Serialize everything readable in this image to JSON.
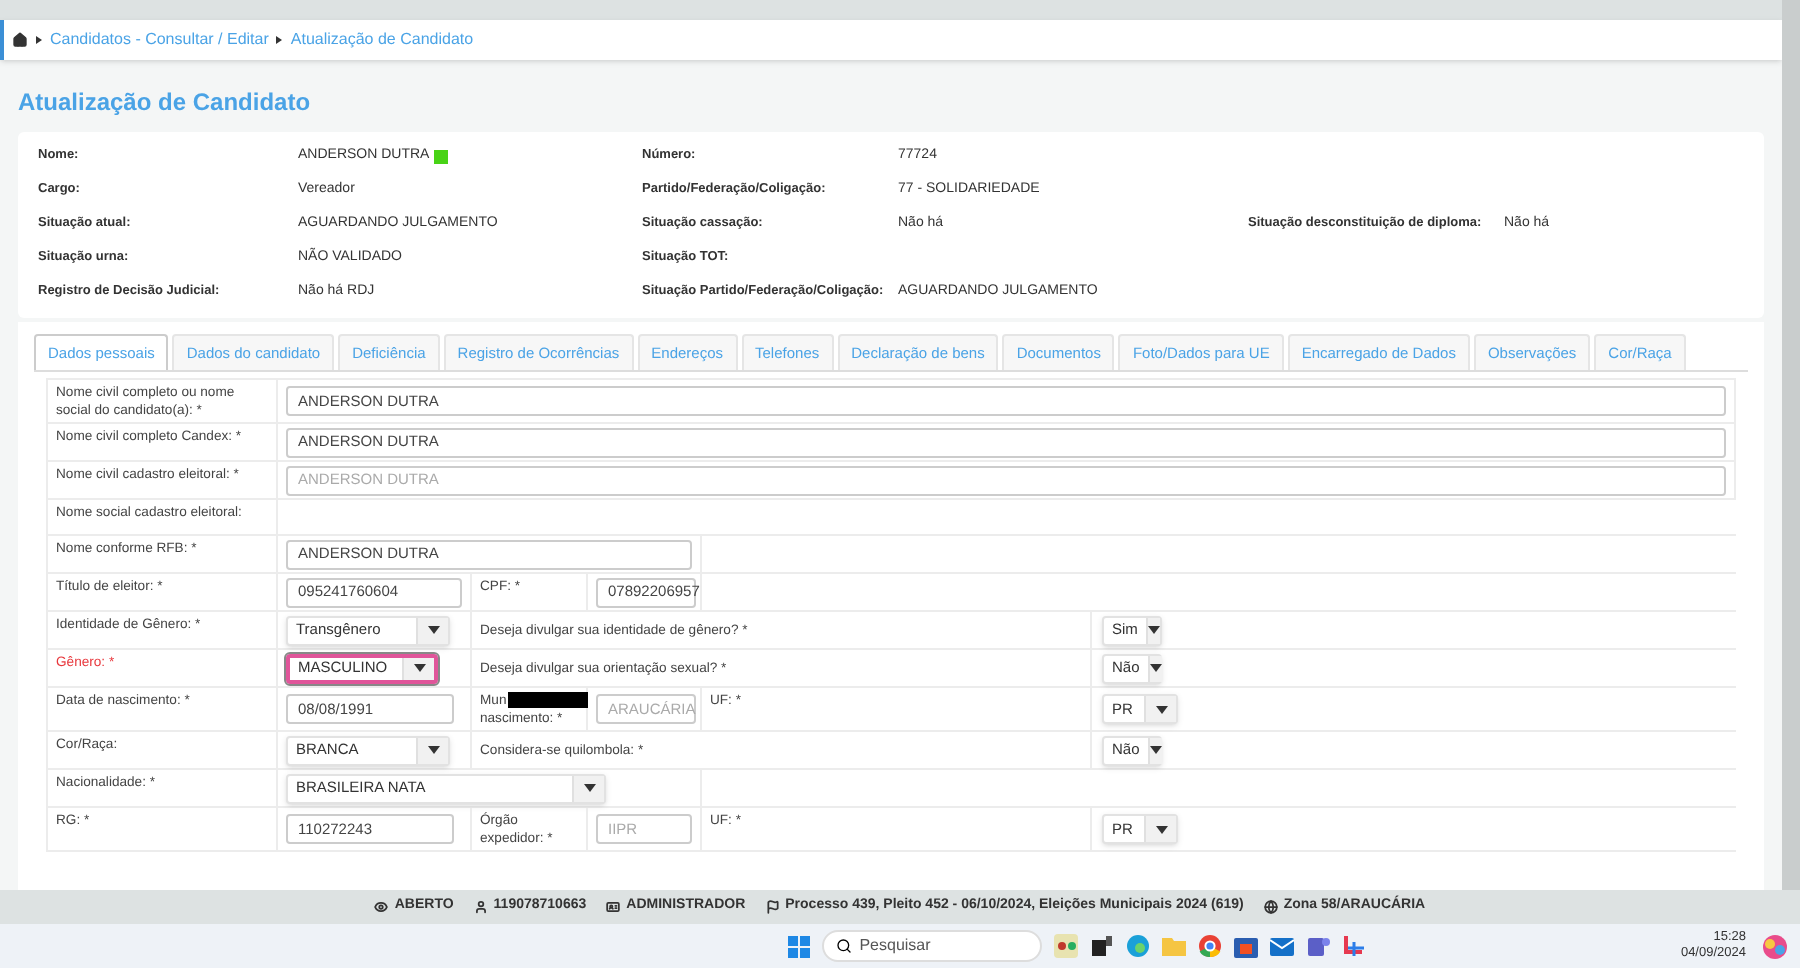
{
  "breadcrumb": [
    "Candidatos - Consultar / Editar",
    "Atualização de Candidato"
  ],
  "page_title": "Atualização de Candidato",
  "summary": [
    {
      "label": "Nome:",
      "value": "ANDERSON DUTRA",
      "badge": true,
      "label2": "Número:",
      "value2": "77724"
    },
    {
      "label": "Cargo:",
      "value": "Vereador",
      "badge": false,
      "label2": "Partido/Federação/Coligação:",
      "value2": "77 - SOLIDARIEDADE"
    },
    {
      "label": "Situação atual:",
      "value": "AGUARDANDO JULGAMENTO",
      "badge": false,
      "label2": "Situação cassação:",
      "value2": "Não há",
      "label3": "Situação desconstituição de diploma:",
      "value3": "Não há"
    },
    {
      "label": "Situação urna:",
      "value": "NÃO VALIDADO",
      "badge": false,
      "label2": "Situação TOT:"
    },
    {
      "label": "Registro de Decisão Judicial:",
      "value": "Não há RDJ",
      "badge": false,
      "label2": "Situação Partido/Federação/Coligação:",
      "value2": "AGUARDANDO JULGAMENTO"
    }
  ],
  "tabs": [
    {
      "label": "Dados pessoais",
      "selected": true
    },
    {
      "label": "Dados do candidato",
      "selected": false
    },
    {
      "label": "Deficiência",
      "selected": false
    },
    {
      "label": "Registro de Ocorrências",
      "selected": false
    },
    {
      "label": "Endereços",
      "selected": false
    },
    {
      "label": "Telefones",
      "selected": false
    },
    {
      "label": "Declaração de bens",
      "selected": false
    },
    {
      "label": "Documentos",
      "selected": false
    },
    {
      "label": "Foto/Dados para UE",
      "selected": false
    },
    {
      "label": "Encarregado de Dados",
      "selected": false
    },
    {
      "label": "Observações",
      "selected": false
    },
    {
      "label": "Cor/Raça",
      "selected": false
    }
  ],
  "form_rows": [
    {
      "kind": "full",
      "label": "Nome civil completo ou nome social do candidato(a): *",
      "value": "ANDERSON DUTRA",
      "disabled": false
    },
    {
      "kind": "full",
      "label": "Nome civil completo Candex: *",
      "value": "ANDERSON DUTRA",
      "disabled": false
    },
    {
      "kind": "full",
      "label": "Nome civil cadastro eleitoral: *",
      "value": "ANDERSON DUTRA",
      "disabled": true
    },
    {
      "kind": "label-only",
      "label": "Nome social cadastro eleitoral:"
    },
    {
      "kind": "medium",
      "label": "Nome conforme RFB: *",
      "value": "ANDERSON DUTRA"
    },
    {
      "kind": "pair",
      "label": "Título de eleitor: *",
      "value": "095241760604",
      "label2": "CPF: *",
      "value2": "07892206957"
    },
    {
      "kind": "select-question",
      "label": "Identidade de Gênero: *",
      "value": "Transgênero",
      "error": false,
      "question": "Deseja divulgar sua identidade de gênero? *",
      "answer": "Sim"
    },
    {
      "kind": "select-question",
      "label": "Gênero: *",
      "value": "MASCULINO",
      "error": true,
      "question": "Deseja divulgar sua orientação sexual? *",
      "answer": "Não"
    },
    {
      "kind": "triple",
      "label": "Data de nascimento: *",
      "value": "08/08/1991",
      "label2_lines": [
        "Mun",
        "nascimento: *"
      ],
      "redacted": true,
      "value2": "ARAUCÁRIA",
      "label3": "UF: *",
      "value3": "PR"
    },
    {
      "kind": "select-question",
      "label": "Cor/Raça:",
      "value": "BRANCA",
      "error": false,
      "question": "Considera-se quilombola: *",
      "answer": "Não"
    },
    {
      "kind": "select-wide",
      "label": "Nacionalidade: *",
      "value": "BRASILEIRA NATA"
    },
    {
      "kind": "triple",
      "label": "RG: *",
      "value": "110272243",
      "label2_lines": [
        "Órgão",
        "expedidor: *"
      ],
      "redacted": false,
      "value2": "IIPR",
      "label3": "UF: *",
      "value3": "PR"
    }
  ],
  "status_bar": [
    {
      "kind": "eye",
      "text": "ABERTO"
    },
    {
      "kind": "user",
      "text": "119078710663"
    },
    {
      "kind": "card",
      "text": "ADMINISTRADOR"
    },
    {
      "kind": "flag",
      "text": "Processo 439, Pleito 452 - 06/10/2024, Eleições Municipais 2024 (619)"
    },
    {
      "kind": "globe",
      "text": "Zona 58/ARAUCÁRIA"
    }
  ],
  "taskbar": {
    "search_placeholder": "Pesquisar",
    "time": "15:28",
    "date": "04/09/2024"
  }
}
